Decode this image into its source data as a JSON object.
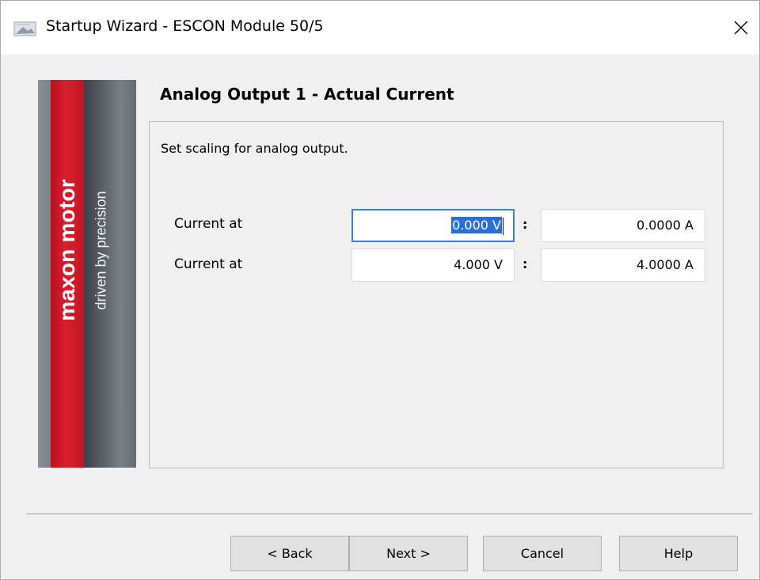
{
  "window": {
    "title": "Startup Wizard - ESCON Module 50/5"
  },
  "banner": {
    "brand": "maxon motor",
    "tagline": "driven by precision"
  },
  "page": {
    "title": "Analog Output 1 - Actual Current",
    "instruction": "Set scaling for analog output."
  },
  "rows": [
    {
      "label": "Current at",
      "voltage": "0.000 V",
      "voltage_selected": "0.000 V",
      "current": "0.0000 A"
    },
    {
      "label": "Current at",
      "voltage": "4.000 V",
      "current": "4.0000 A"
    }
  ],
  "separator": ":",
  "buttons": {
    "back": "< Back",
    "next": "Next >",
    "cancel": "Cancel",
    "help": "Help"
  },
  "colors": {
    "brand_red": "#d8202e",
    "selection": "#2d6ed6",
    "focus_border": "#3f7ad6"
  }
}
